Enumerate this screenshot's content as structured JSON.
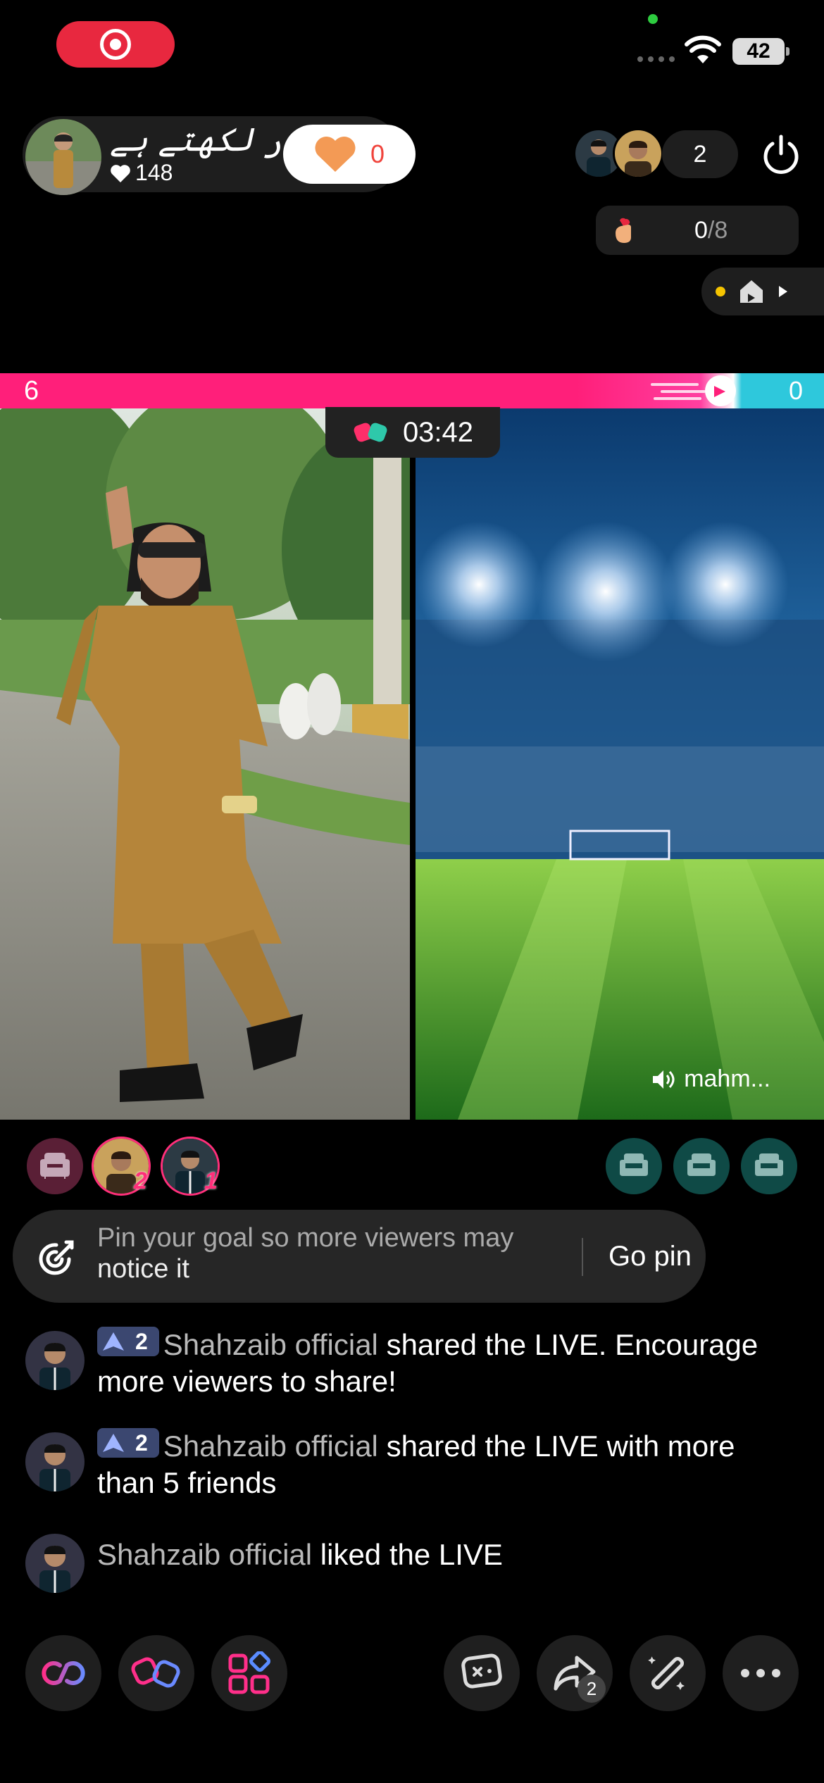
{
  "status_bar": {
    "battery": "42"
  },
  "host": {
    "name": "حیدر لکھتے ہے",
    "likes": "148",
    "hearts": "0"
  },
  "viewers": {
    "count": "2"
  },
  "goal": {
    "current": "0",
    "total": "/8"
  },
  "battle": {
    "score_left": "6",
    "score_right": "0",
    "timer": "03:42",
    "opponent_audio": "mahm..."
  },
  "guests": [
    {
      "rank": "2"
    },
    {
      "rank": "1"
    }
  ],
  "pin_banner": {
    "line1": "Pin your goal so more viewers may",
    "line2": "notice it",
    "action": "Go pin"
  },
  "comments": [
    {
      "badge_level": "2",
      "user": "Shahzaib official",
      "text": " shared the LIVE. Encourage more viewers to share!"
    },
    {
      "badge_level": "2",
      "user": "Shahzaib official",
      "text": " shared the LIVE with more than 5 friends"
    },
    {
      "user": "Shahzaib official",
      "text": " liked the LIVE"
    }
  ],
  "toolbar": {
    "share_count": "2"
  },
  "colors": {
    "accent_pink": "#ff1f7a",
    "accent_teal": "#2ec8dc",
    "rec_red": "#e8283f"
  }
}
